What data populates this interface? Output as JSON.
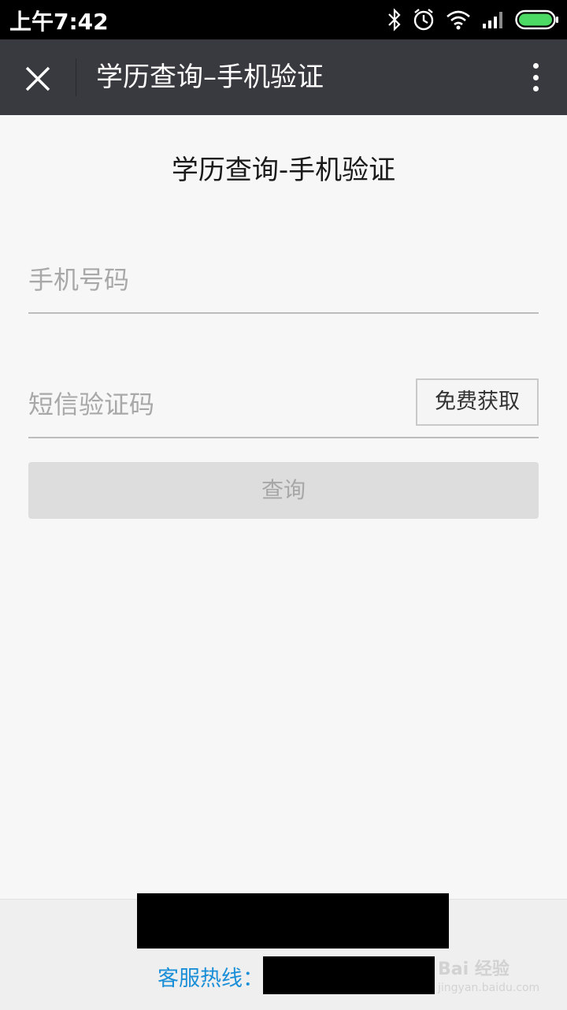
{
  "status_bar": {
    "time": "上午7:42",
    "icons": [
      "bluetooth-icon",
      "alarm-icon",
      "wifi-icon",
      "signal-icon",
      "battery-icon"
    ],
    "battery_color": "#4cd964"
  },
  "nav_bar": {
    "title": "学历查询–手机验证",
    "background": "#393a3f"
  },
  "main": {
    "heading": "学历查询-手机验证",
    "phone_placeholder": "手机号码",
    "sms_placeholder": "短信验证码",
    "get_code_label": "免费获取",
    "query_label": "查询"
  },
  "footer": {
    "hotline_label": "客服热线：",
    "hotline_color": "#1a8fd8",
    "watermark": "Bai 经验",
    "watermark_sub": "jingyan.baidu.com"
  }
}
